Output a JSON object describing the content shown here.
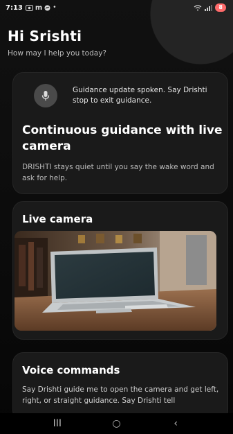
{
  "status_bar": {
    "time": "7:13",
    "notification_icons": [
      "screen-record-icon",
      "m-app-icon",
      "messenger-icon",
      "dot-icon"
    ],
    "battery_level": "8",
    "battery_color": "#ff6b6b"
  },
  "header": {
    "greeting": "Hi Srishti",
    "subtitle": "How may I help you today?"
  },
  "guidance_card": {
    "mic_icon": "mic-icon",
    "spoken_text": "Guidance update spoken. Say Drishti stop to exit guidance.",
    "title": "Continuous guidance with live camera",
    "description": "DRISHTI stays quiet until you say the wake word and ask for help."
  },
  "camera_card": {
    "title": "Live camera"
  },
  "voice_card": {
    "title": "Voice commands",
    "text": "Say Drishti guide me to open the camera and get left, right, or straight guidance. Say Drishti tell"
  },
  "nav_bar": {
    "recent": "III",
    "home": "○",
    "back": "‹"
  }
}
